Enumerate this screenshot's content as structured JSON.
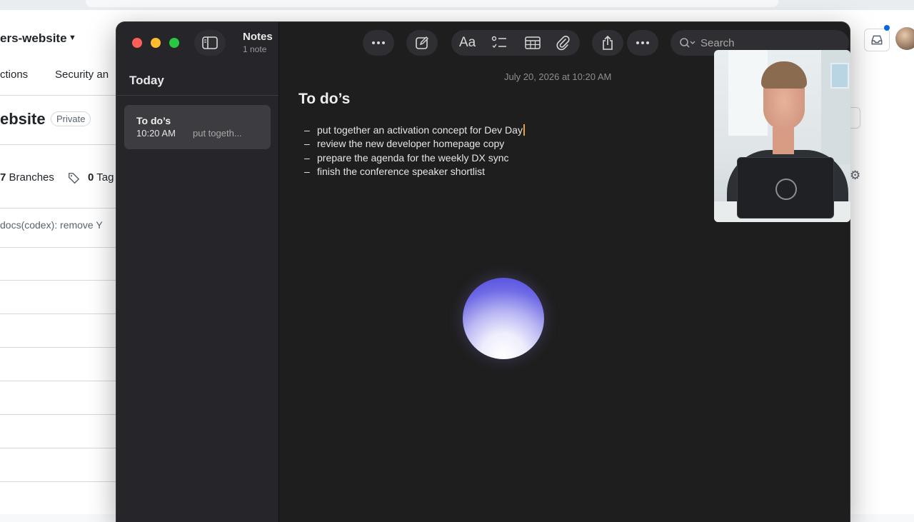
{
  "background": {
    "repo_name": "ers-website",
    "nav": {
      "actions": "ctions",
      "security": "Security an"
    },
    "repo_title": "ebsite",
    "visibility": "Private",
    "branches_count": "7",
    "branches_label": "Branches",
    "tags_count": "0",
    "tags_label": "Tag",
    "latest_commit": "docs(codex): remove Y"
  },
  "notes_app": {
    "title": "Notes",
    "count": "1 note",
    "search_placeholder": "Search",
    "format_label": "Aa",
    "sidebar_section": "Today",
    "note_card": {
      "title": "To do’s",
      "time": "10:20 AM",
      "snippet": "put togeth..."
    },
    "editor": {
      "date": "July 20, 2026 at 10:20 AM",
      "title": "To do’s",
      "bullet": "–",
      "items": [
        "put together an activation concept for Dev Day",
        "review the new developer homepage copy",
        "prepare the agenda for the weekly DX sync",
        "finish the conference speaker shortlist"
      ]
    }
  },
  "colors": {
    "traffic_close": "#ff5f57",
    "traffic_minimize": "#febc2e",
    "traffic_zoom": "#28c840",
    "cursor": "#e5a43a"
  }
}
